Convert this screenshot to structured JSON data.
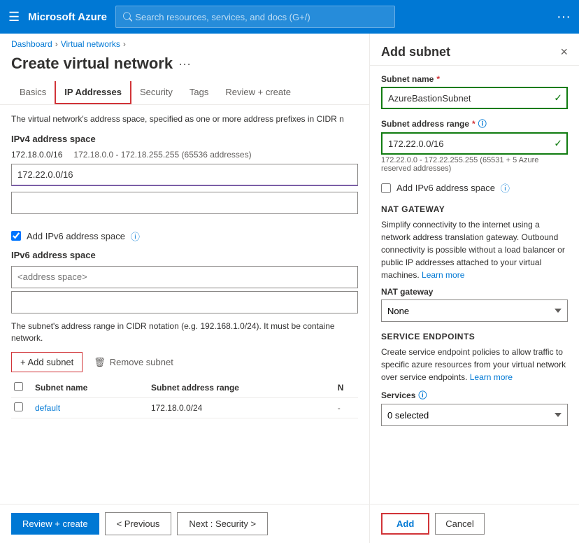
{
  "topNav": {
    "hamburger": "☰",
    "title": "Microsoft Azure",
    "searchPlaceholder": "Search resources, services, and docs (G+/)",
    "dots": "···"
  },
  "breadcrumb": {
    "items": [
      "Dashboard",
      "Virtual networks"
    ],
    "separators": [
      ">",
      ">"
    ]
  },
  "pageTitle": {
    "text": "Create virtual network",
    "dots": "···"
  },
  "tabs": [
    {
      "label": "Basics",
      "state": "normal"
    },
    {
      "label": "IP Addresses",
      "state": "active"
    },
    {
      "label": "Security",
      "state": "normal"
    },
    {
      "label": "Tags",
      "state": "normal"
    },
    {
      "label": "Review + create",
      "state": "normal"
    }
  ],
  "ipAddresses": {
    "description": "The virtual network's address space, specified as one or more address prefixes in CIDR n",
    "ipv4SectionTitle": "IPv4 address space",
    "addresses": [
      {
        "cidr": "172.18.0.0/16",
        "range": "172.18.0.0 - 172.18.255.255 (65536 addresses)"
      }
    ],
    "inputValue1": "172.22.0.0/16",
    "inputValue2": "",
    "checkboxLabel": "Add IPv6 address space",
    "infoIcon": "ⓘ",
    "ipv6SectionTitle": "IPv6 address space",
    "ipv6Placeholder": "<address space>",
    "subnetDesc": "The subnet's address range in CIDR notation (e.g. 192.168.1.0/24). It must be containe network.",
    "addSubnetLabel": "+ Add subnet",
    "removeSubnetLabel": "Remove subnet",
    "tableHeaders": [
      "Subnet name",
      "Subnet address range",
      "N"
    ],
    "tableRows": [
      {
        "name": "default",
        "range": "172.18.0.0/24",
        "extra": "-"
      }
    ]
  },
  "bottomBar": {
    "reviewCreate": "Review + create",
    "previous": "< Previous",
    "nextSecurity": "Next : Security >"
  },
  "addSubnetPanel": {
    "title": "Add subnet",
    "closeIcon": "×",
    "subnetNameLabel": "Subnet name",
    "subnetNameRequired": "*",
    "subnetNameValue": "AzureBastionSubnet",
    "subnetAddressRangeLabel": "Subnet address range",
    "subnetAddressRangeRequired": "*",
    "subnetAddressRangeValue": "172.22.0.0/16",
    "subnetAddressRangeHint": "172.22.0.0 - 172.22.255.255 (65531 + 5 Azure reserved addresses)",
    "addIpv6CheckboxLabel": "Add IPv6 address space",
    "natGatewayHeader": "NAT GATEWAY",
    "natGatewayDesc": "Simplify connectivity to the internet using a network address translation gateway. Outbound connectivity is possible without a load balancer or public IP addresses attached to your virtual machines.",
    "natGatewayLearnMore": "Learn more",
    "natGatewayLabel": "NAT gateway",
    "natGatewayValue": "None",
    "serviceEndpointsHeader": "SERVICE ENDPOINTS",
    "serviceEndpointsDesc": "Create service endpoint policies to allow traffic to specific azure resources from your virtual network over service endpoints.",
    "serviceEndpointsLearnMore": "Learn more",
    "servicesLabel": "Services",
    "servicesInfoIcon": "ⓘ",
    "servicesValue": "0 selected",
    "addButton": "Add",
    "cancelButton": "Cancel"
  }
}
